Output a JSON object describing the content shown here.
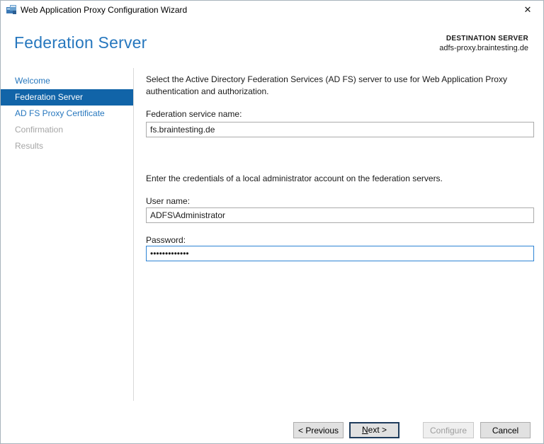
{
  "window": {
    "title": "Web Application Proxy Configuration Wizard",
    "close_glyph": "✕"
  },
  "header": {
    "page_title": "Federation Server",
    "destination_label": "DESTINATION SERVER",
    "destination_server": "adfs-proxy.braintesting.de"
  },
  "sidebar": {
    "items": [
      {
        "label": "Welcome",
        "state": "normal"
      },
      {
        "label": "Federation Server",
        "state": "selected"
      },
      {
        "label": "AD FS Proxy Certificate",
        "state": "normal"
      },
      {
        "label": "Confirmation",
        "state": "disabled"
      },
      {
        "label": "Results",
        "state": "disabled"
      }
    ]
  },
  "content": {
    "intro": "Select the Active Directory Federation Services (AD FS) server to use for Web Application Proxy authentication and authorization.",
    "federation_service": {
      "label": "Federation service name:",
      "value": "fs.braintesting.de"
    },
    "credentials_instruction": "Enter the credentials of a local administrator account on the federation servers.",
    "username": {
      "label": "User name:",
      "value": "ADFS\\Administrator"
    },
    "password": {
      "label": "Password:",
      "value": "•••••••••••••"
    }
  },
  "footer": {
    "previous_label": "< Previous",
    "next_accel": "N",
    "next_rest": "ext >",
    "configure_label": "Configure",
    "cancel_label": "Cancel"
  },
  "colors": {
    "accent_blue": "#2677BE",
    "selected_nav_bg": "#1164A8",
    "disabled_text": "#A6A6A6",
    "focused_input_border": "#2E84D5",
    "button_bg": "#E1E1E1"
  }
}
